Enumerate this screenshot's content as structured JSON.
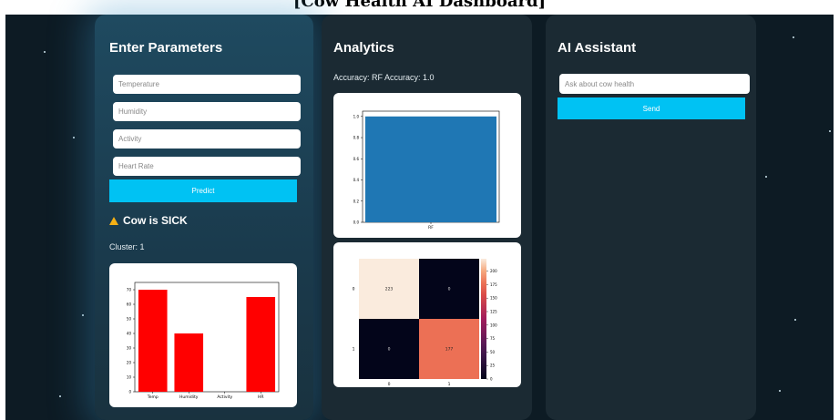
{
  "page_title": "[Cow Health AI Dashboard]",
  "left_panel": {
    "title": "Enter Parameters",
    "fields": [
      {
        "placeholder": "Temperature"
      },
      {
        "placeholder": "Humidity"
      },
      {
        "placeholder": "Activity"
      },
      {
        "placeholder": "Heart Rate"
      }
    ],
    "predict_label": "Predict",
    "status": "Cow is SICK",
    "status_icon": "warning-icon",
    "status_icon_color": "#f5b015",
    "cluster": "Cluster: 1"
  },
  "middle_panel": {
    "title": "Analytics",
    "accuracy": "Accuracy: RF Accuracy: 1.0"
  },
  "right_panel": {
    "title": "AI Assistant",
    "input_placeholder": "Ask about cow health",
    "send_label": "Send"
  },
  "colors": {
    "accent": "#00c2f3",
    "bar_red": "#ff0000",
    "bar_blue": "#1f77b4"
  },
  "chart_data": [
    {
      "type": "bar",
      "categories": [
        "Temp",
        "Humidity",
        "Activity",
        "HR"
      ],
      "values": [
        70,
        40,
        0,
        65
      ],
      "ylim": [
        0,
        75
      ],
      "yticks": [
        0,
        10,
        20,
        30,
        40,
        50,
        60,
        70
      ],
      "color": "#ff0000"
    },
    {
      "type": "bar",
      "categories": [
        "RF"
      ],
      "values": [
        1.0
      ],
      "ylim": [
        0,
        1.05
      ],
      "yticks": [
        0.0,
        0.2,
        0.4,
        0.6,
        0.8,
        1.0
      ],
      "color": "#1f77b4"
    },
    {
      "type": "heatmap",
      "x_labels": [
        "0",
        "1"
      ],
      "y_labels": [
        "0",
        "1"
      ],
      "values": [
        [
          223,
          0
        ],
        [
          0,
          177
        ]
      ],
      "colorbar_ticks": [
        0,
        25,
        50,
        75,
        100,
        125,
        150,
        175,
        200
      ]
    }
  ]
}
